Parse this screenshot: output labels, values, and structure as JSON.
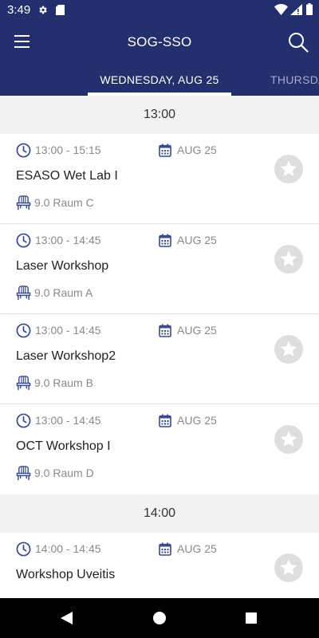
{
  "status_bar": {
    "time": "3:49"
  },
  "toolbar": {
    "title": "SOG-SSO"
  },
  "tabs": {
    "active": "WEDNESDAY, AUG 25",
    "next": "THURSDAY"
  },
  "sections": [
    {
      "time": "13:00",
      "sessions": [
        {
          "time_range": "13:00 - 15:15",
          "date": "AUG 25",
          "title": "ESASO Wet Lab I",
          "room": "9.0 Raum C"
        },
        {
          "time_range": "13:00 - 14:45",
          "date": "AUG 25",
          "title": "Laser Workshop",
          "room": "9.0 Raum A"
        },
        {
          "time_range": "13:00 - 14:45",
          "date": "AUG 25",
          "title": "Laser Workshop2",
          "room": "9.0 Raum B"
        },
        {
          "time_range": "13:00 - 14:45",
          "date": "AUG 25",
          "title": "OCT Workshop I",
          "room": "9.0 Raum D"
        }
      ]
    },
    {
      "time": "14:00",
      "sessions": [
        {
          "time_range": "14:00 - 14:45",
          "date": "AUG 25",
          "title": "Workshop Uveitis",
          "room": ""
        }
      ]
    }
  ],
  "colors": {
    "primary": "#24306e",
    "icon": "#3a4a8c",
    "favorite": "#dedede",
    "section_bg": "#f2f2f2"
  },
  "icons": {
    "menu": "hamburger-icon",
    "search": "search-icon",
    "clock": "clock-icon",
    "calendar": "calendar-icon",
    "room": "chair-icon",
    "favorite": "star-icon"
  }
}
